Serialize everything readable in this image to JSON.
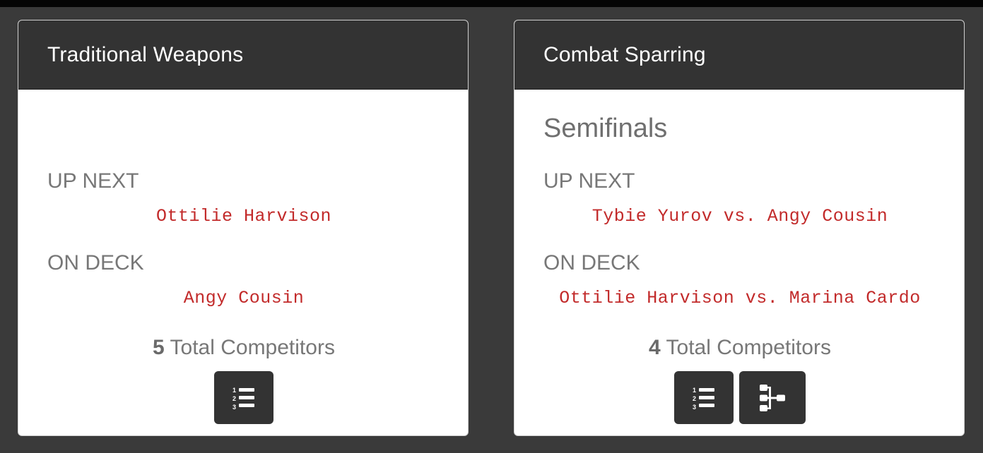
{
  "cards": [
    {
      "title": "Traditional Weapons",
      "round": "",
      "up_next_label": "UP NEXT",
      "up_next": "Ottilie Harvison",
      "on_deck_label": "ON DECK",
      "on_deck": "Angy Cousin",
      "total_count": "5",
      "total_label": "Total Competitors",
      "buttons": [
        "ordered-list-icon"
      ]
    },
    {
      "title": "Combat Sparring",
      "round": "Semifinals",
      "up_next_label": "UP NEXT",
      "up_next": "Tybie Yurov vs. Angy Cousin",
      "on_deck_label": "ON DECK",
      "on_deck": "Ottilie Harvison vs. Marina Cardo",
      "total_count": "4",
      "total_label": "Total Competitors",
      "buttons": [
        "ordered-list-icon",
        "bracket-tree-icon"
      ]
    }
  ],
  "colors": {
    "background": "#3a3a3a",
    "header": "#333333",
    "competitor_text": "#c22a2a",
    "label_text": "#777777"
  }
}
